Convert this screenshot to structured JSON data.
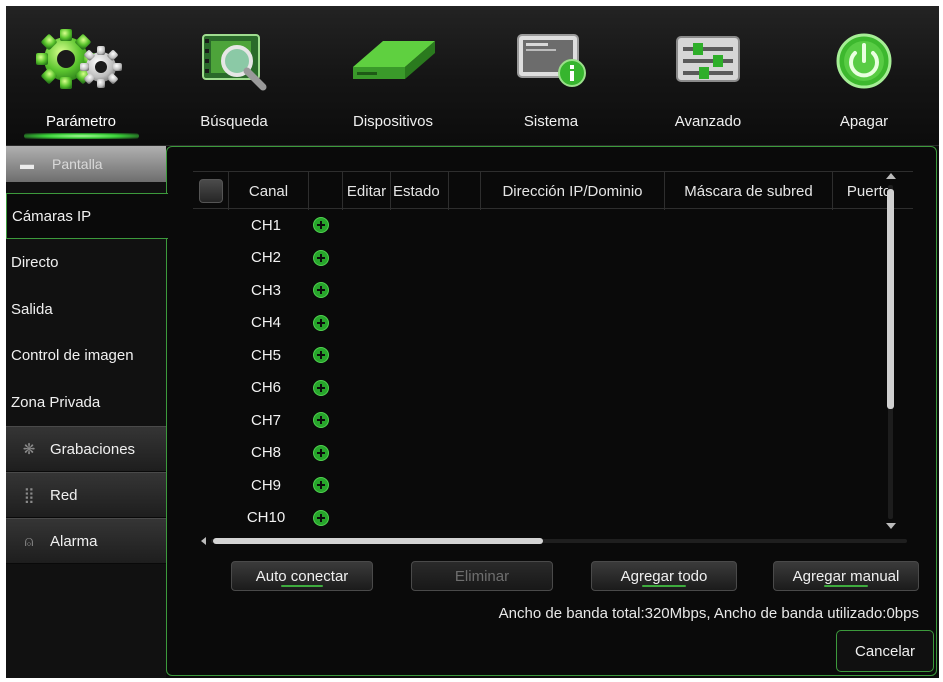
{
  "nav": [
    {
      "label": "Parámetro",
      "icon": "gears-icon",
      "active": true
    },
    {
      "label": "Búsqueda",
      "icon": "video-search-icon",
      "active": false
    },
    {
      "label": "Dispositivos",
      "icon": "hard-drive-icon",
      "active": false
    },
    {
      "label": "Sistema",
      "icon": "system-info-icon",
      "active": false
    },
    {
      "label": "Avanzado",
      "icon": "sliders-icon",
      "active": false
    },
    {
      "label": "Apagar",
      "icon": "power-icon",
      "active": false
    }
  ],
  "sidebar": {
    "pantalla": "Pantalla",
    "items": [
      "Cámaras IP",
      "Directo",
      "Salida",
      "Control de imagen",
      "Zona Privada"
    ],
    "selected": "Cámaras IP",
    "groups": [
      {
        "label": "Grabaciones",
        "icon": "recordings-icon"
      },
      {
        "label": "Red",
        "icon": "network-icon"
      },
      {
        "label": "Alarma",
        "icon": "alarm-icon"
      }
    ]
  },
  "table": {
    "headers": {
      "canal": "Canal",
      "editar": "Editar",
      "estado": "Estado",
      "ip": "Dirección IP/Dominio",
      "mascara": "Máscara de subred",
      "puerto": "Puerto"
    },
    "rows": [
      "CH1",
      "CH2",
      "CH3",
      "CH4",
      "CH5",
      "CH6",
      "CH7",
      "CH8",
      "CH9",
      "CH10"
    ]
  },
  "buttons": {
    "auto": "Auto conectar",
    "eliminar": "Eliminar",
    "agregar_todo": "Agregar todo",
    "agregar_manual": "Agregar manual",
    "cancelar": "Cancelar"
  },
  "bandwidth": "Ancho de banda total:320Mbps, Ancho de banda utilizado:0bps",
  "colors": {
    "accent": "#3bd33a",
    "border": "#3c9a3c",
    "background": "#0b0b0b"
  }
}
